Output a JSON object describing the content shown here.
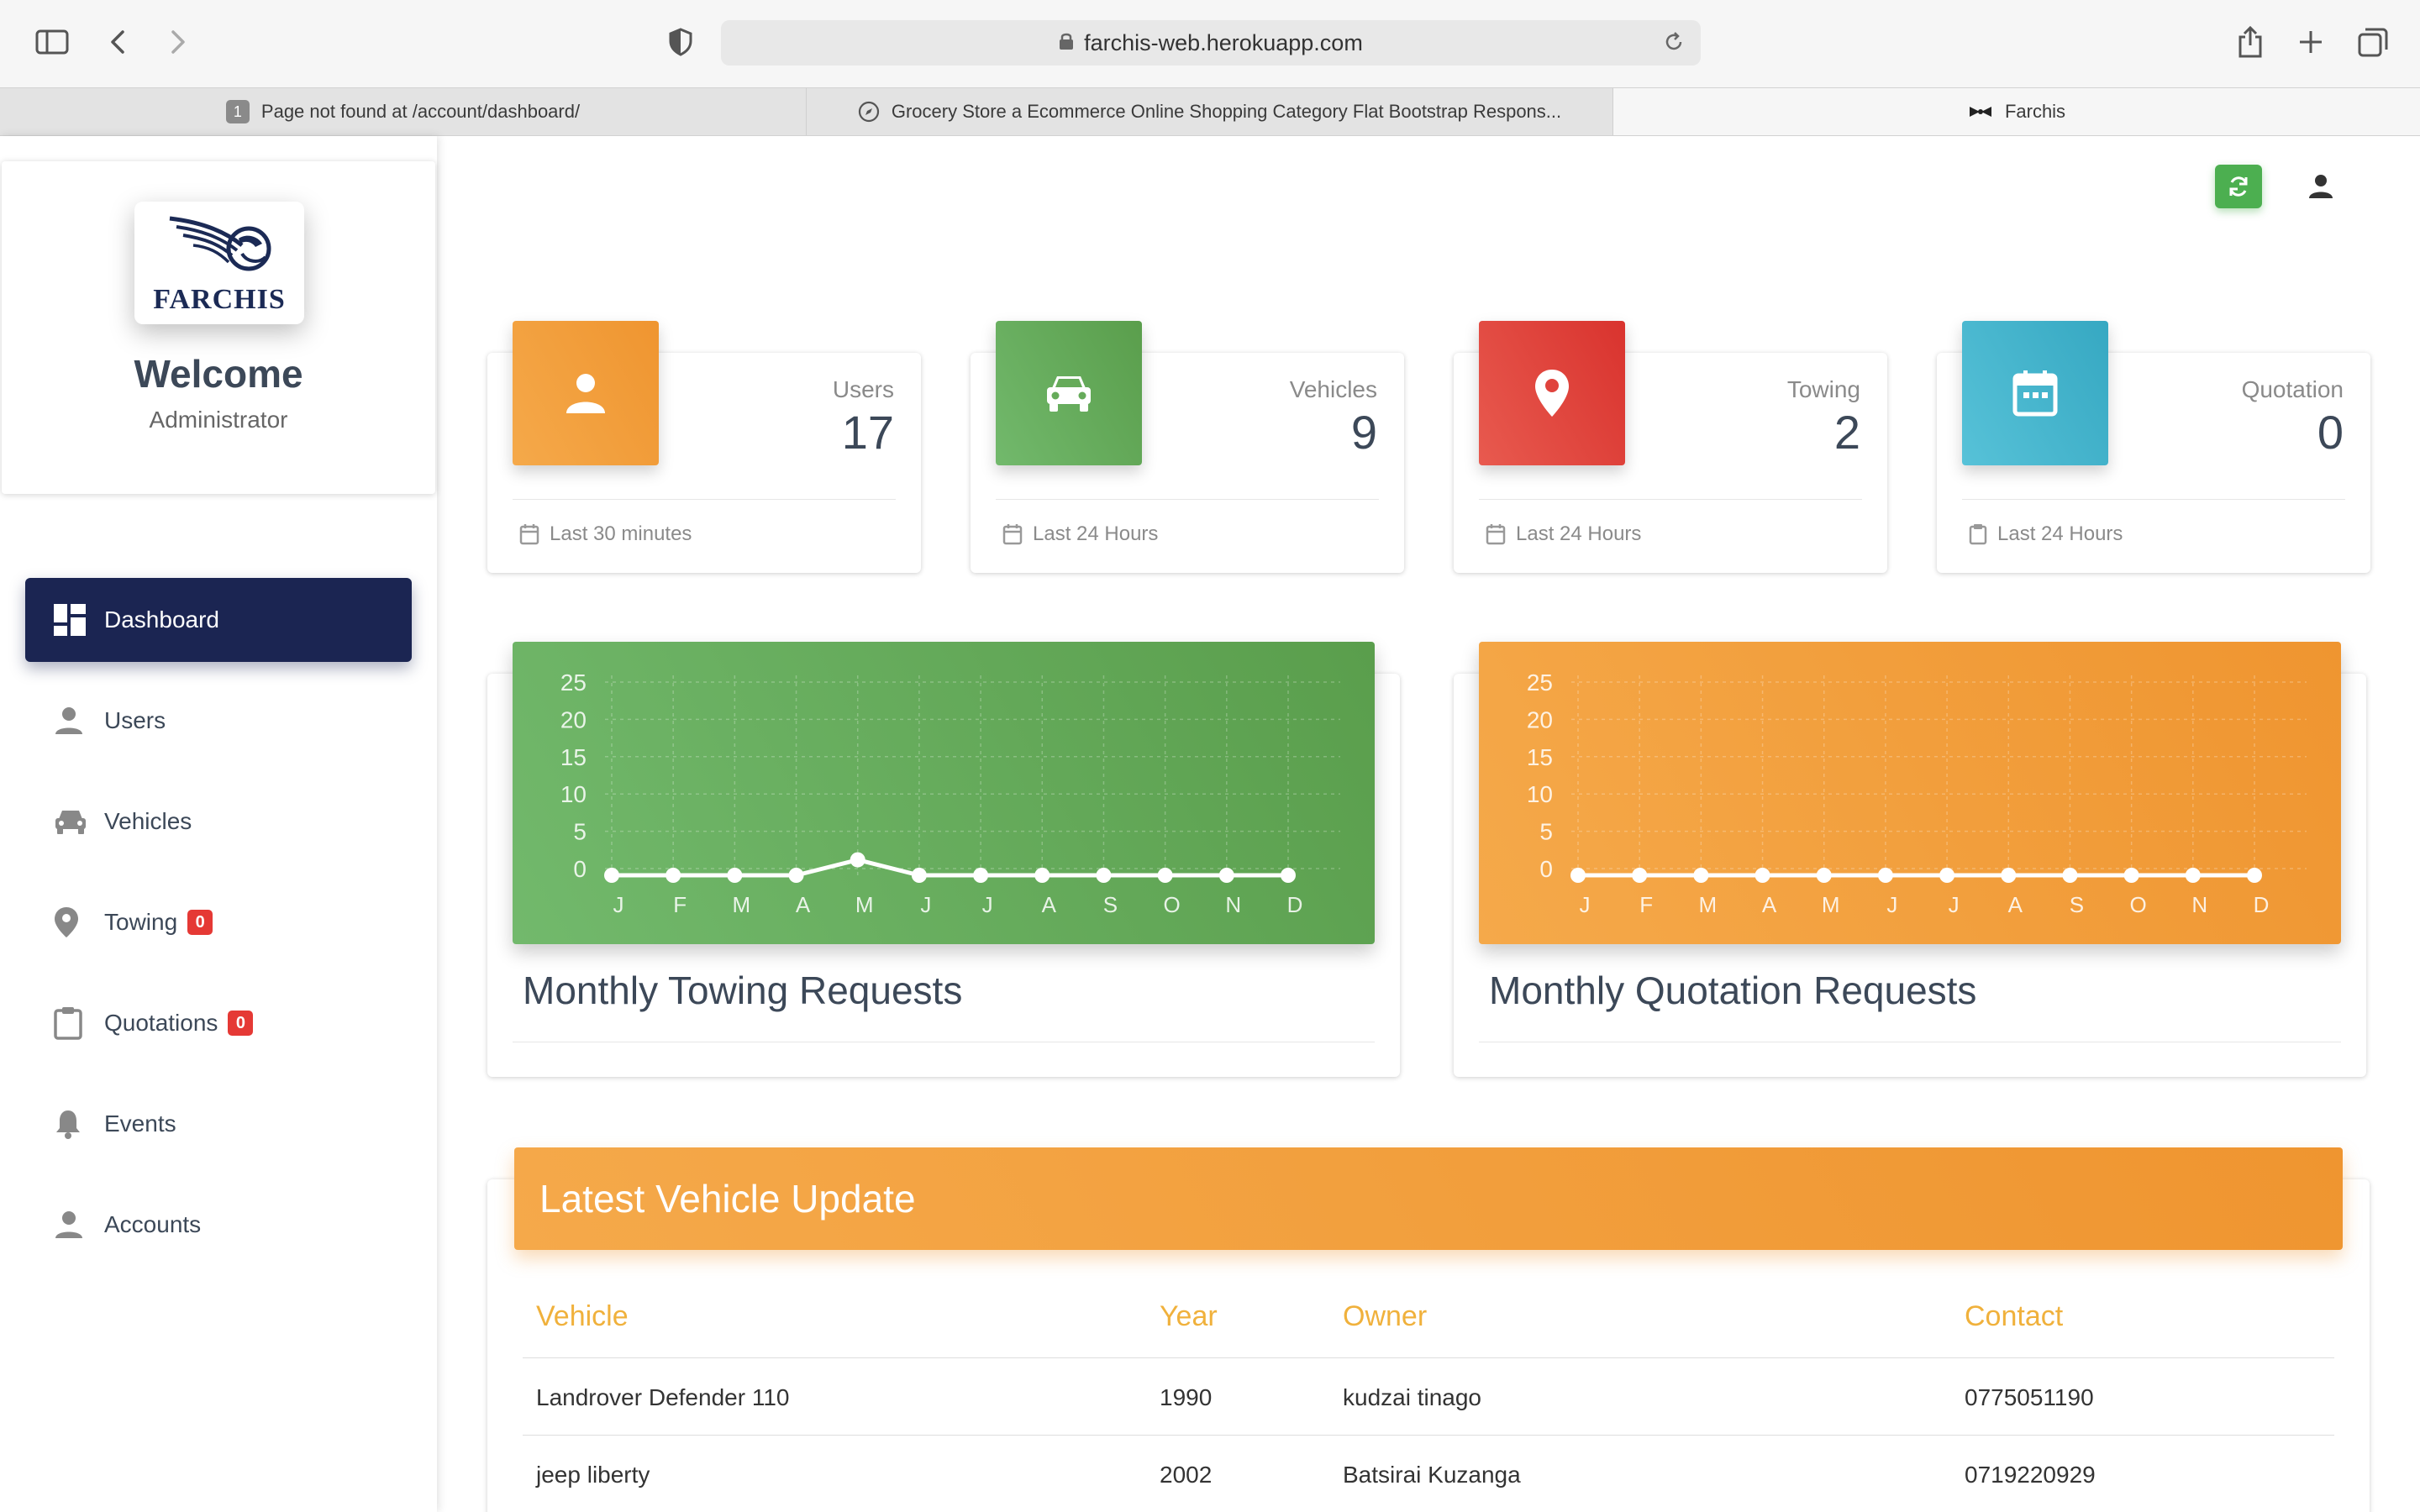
{
  "browser": {
    "url": "farchis-web.herokuapp.com",
    "tabs": [
      {
        "label": "Page not found at /account/dashboard/",
        "badge": "1"
      },
      {
        "label": "Grocery Store a Ecommerce Online Shopping Category Flat Bootstrap Respons..."
      },
      {
        "label": "Farchis"
      }
    ]
  },
  "sidebar": {
    "logo_text": "FARCHIS",
    "welcome": "Welcome",
    "role": "Administrator",
    "items": [
      {
        "label": "Dashboard",
        "icon": "dashboard-icon"
      },
      {
        "label": "Users",
        "icon": "person-icon"
      },
      {
        "label": "Vehicles",
        "icon": "car-icon"
      },
      {
        "label": "Towing",
        "icon": "location-pin-icon",
        "badge": "0"
      },
      {
        "label": "Quotations",
        "icon": "clipboard-icon",
        "badge": "0"
      },
      {
        "label": "Events",
        "icon": "bell-icon"
      },
      {
        "label": "Accounts",
        "icon": "person-icon"
      }
    ]
  },
  "stats": [
    {
      "label": "Users",
      "value": "17",
      "footer": "Last 30 minutes",
      "color": "#ef9530",
      "icon": "person-icon"
    },
    {
      "label": "Vehicles",
      "value": "9",
      "footer": "Last 24 Hours",
      "color": "#5aa64e",
      "icon": "car-icon"
    },
    {
      "label": "Towing",
      "value": "2",
      "footer": "Last 24 Hours",
      "color": "#e0433d",
      "icon": "location-pin-icon"
    },
    {
      "label": "Quotation",
      "value": "0",
      "footer": "Last 24 Hours",
      "color": "#3fb3cb",
      "icon": "calendar-icon"
    }
  ],
  "charts": {
    "towing_title": "Monthly Towing Requests",
    "quotation_title": "Monthly Quotation Requests"
  },
  "chart_data": [
    {
      "type": "line",
      "categories": [
        "J",
        "F",
        "M",
        "A",
        "M",
        "J",
        "J",
        "A",
        "S",
        "O",
        "N",
        "D"
      ],
      "values": [
        0,
        0,
        0,
        0,
        2,
        0,
        0,
        0,
        0,
        0,
        0,
        0
      ],
      "ylim": [
        0,
        25
      ],
      "yticks": [
        "25",
        "20",
        "15",
        "10",
        "5",
        "0"
      ],
      "grid": true,
      "background": "#66ab5a"
    },
    {
      "type": "line",
      "categories": [
        "J",
        "F",
        "M",
        "A",
        "M",
        "J",
        "J",
        "A",
        "S",
        "O",
        "N",
        "D"
      ],
      "values": [
        0,
        0,
        0,
        0,
        0,
        0,
        0,
        0,
        0,
        0,
        0,
        0
      ],
      "ylim": [
        0,
        25
      ],
      "yticks": [
        "25",
        "20",
        "15",
        "10",
        "5",
        "0"
      ],
      "grid": true,
      "background": "#f19b38"
    }
  ],
  "table": {
    "title": "Latest Vehicle Update",
    "columns": [
      "Vehicle",
      "Year",
      "Owner",
      "Contact"
    ],
    "rows": [
      [
        "Landrover Defender 110",
        "1990",
        "kudzai tinago",
        "0775051190"
      ],
      [
        "jeep liberty",
        "2002",
        "Batsirai Kuzanga",
        "0719220929"
      ]
    ]
  },
  "colors": {
    "sidebar_active": "#1b2552",
    "refresh": "#4caf50",
    "table_header": "#f19b38",
    "table_column": "#f0b13c"
  }
}
